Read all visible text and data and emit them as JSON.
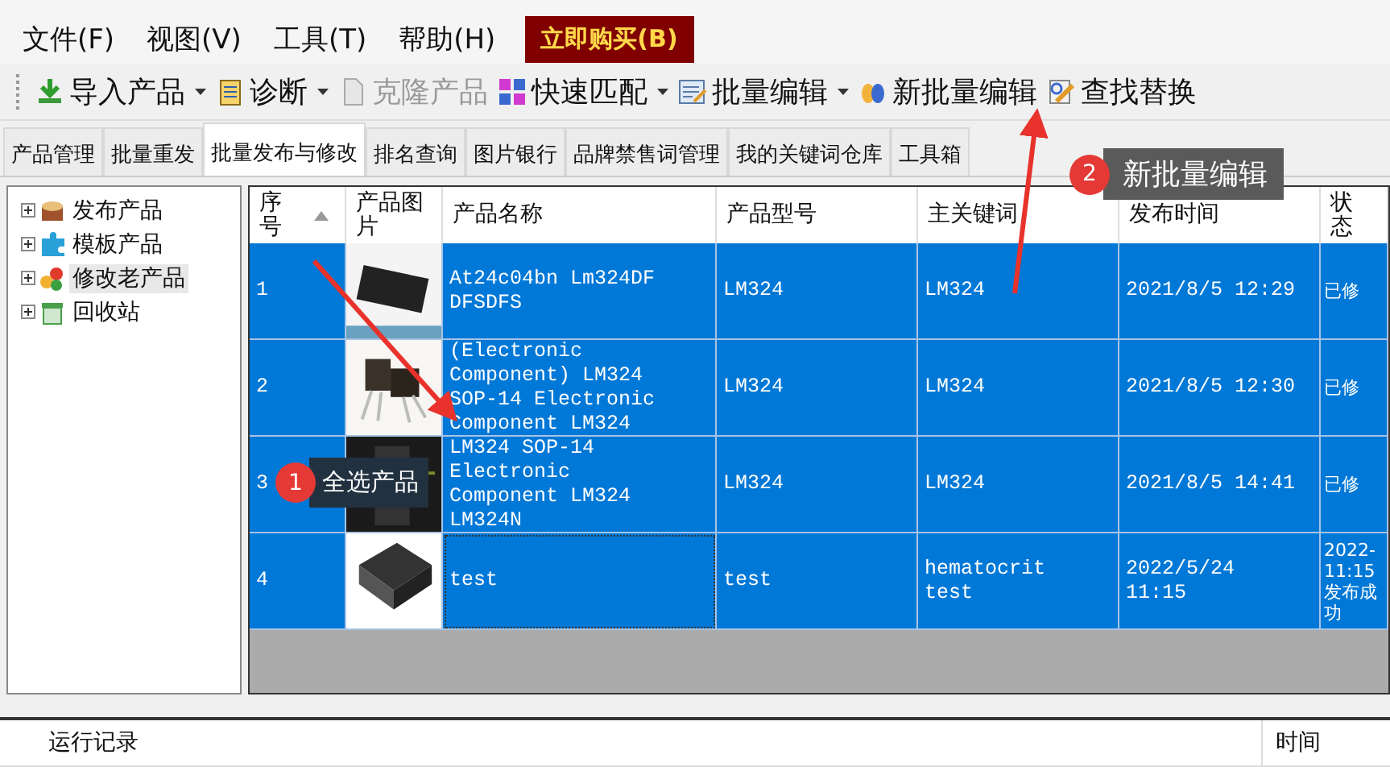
{
  "menu": [
    {
      "label": "文件(F)",
      "kind": "menu"
    },
    {
      "label": "视图(V)",
      "kind": "menu"
    },
    {
      "label": "工具(T)",
      "kind": "menu"
    },
    {
      "label": "帮助(H)",
      "kind": "menu"
    },
    {
      "label": "立即购买(B)",
      "kind": "buy"
    }
  ],
  "toolbar": [
    {
      "label": "导入产品",
      "dropdown": true,
      "disabled": false
    },
    {
      "label": "诊断",
      "dropdown": true,
      "disabled": false
    },
    {
      "label": "克隆产品",
      "dropdown": false,
      "disabled": true
    },
    {
      "label": "快速匹配",
      "dropdown": true,
      "disabled": false
    },
    {
      "label": "批量编辑",
      "dropdown": true,
      "disabled": false
    },
    {
      "label": "新批量编辑",
      "dropdown": false,
      "disabled": false
    },
    {
      "label": "查找替换",
      "dropdown": false,
      "disabled": false
    }
  ],
  "tabs": [
    {
      "label": "产品管理",
      "selected": false
    },
    {
      "label": "批量重发",
      "selected": false
    },
    {
      "label": "批量发布与修改",
      "selected": true
    },
    {
      "label": "排名查询",
      "selected": false
    },
    {
      "label": "图片银行",
      "selected": false
    },
    {
      "label": "品牌禁售词管理",
      "selected": false
    },
    {
      "label": "我的关键词仓库",
      "selected": false
    },
    {
      "label": "工具箱",
      "selected": false
    }
  ],
  "tree": [
    {
      "label": "发布产品",
      "expanded": false,
      "selected": false
    },
    {
      "label": "模板产品",
      "expanded": false,
      "selected": false
    },
    {
      "label": "修改老产品",
      "expanded": false,
      "selected": true
    },
    {
      "label": "回收站",
      "expanded": false,
      "selected": false
    }
  ],
  "table": {
    "columns": [
      {
        "label": "序号",
        "sorted": true
      },
      {
        "label": "产品图片",
        "sorted": false
      },
      {
        "label": "产品名称",
        "sorted": false
      },
      {
        "label": "产品型号",
        "sorted": false
      },
      {
        "label": "主关键词",
        "sorted": false
      },
      {
        "label": "发布时间",
        "sorted": false
      },
      {
        "label": "状态",
        "sorted": false
      }
    ],
    "rows": [
      {
        "selected": true,
        "focused": false,
        "no": "1",
        "name": "At24c04bn Lm324DF DFSDFS",
        "model": "LM324",
        "keyword": "LM324",
        "time": "2021/8/5 12:29",
        "status": "已修"
      },
      {
        "selected": true,
        "focused": false,
        "no": "2",
        "name": "(Electronic Component)  LM324 SOP-14 Electronic Component LM324",
        "model": "LM324",
        "keyword": "LM324",
        "time": "2021/8/5 12:30",
        "status": "已修"
      },
      {
        "selected": true,
        "focused": false,
        "no": "3",
        "name": "LM324 SOP-14 Electronic Component LM324 LM324N",
        "model": "LM324",
        "keyword": "LM324",
        "time": "2021/8/5 14:41",
        "status": "已修"
      },
      {
        "selected": true,
        "focused": true,
        "no": "4",
        "name": "test",
        "model": "test",
        "keyword": "hematocrit test",
        "time": "2022/5/24 11:15",
        "status": "2022- 11:15 发布成功"
      }
    ]
  },
  "log": {
    "columns": [
      "运行记录",
      "时间"
    ]
  },
  "annotations": [
    {
      "number": "1",
      "text": "全选产品"
    },
    {
      "number": "2",
      "text": "新批量编辑"
    }
  ]
}
